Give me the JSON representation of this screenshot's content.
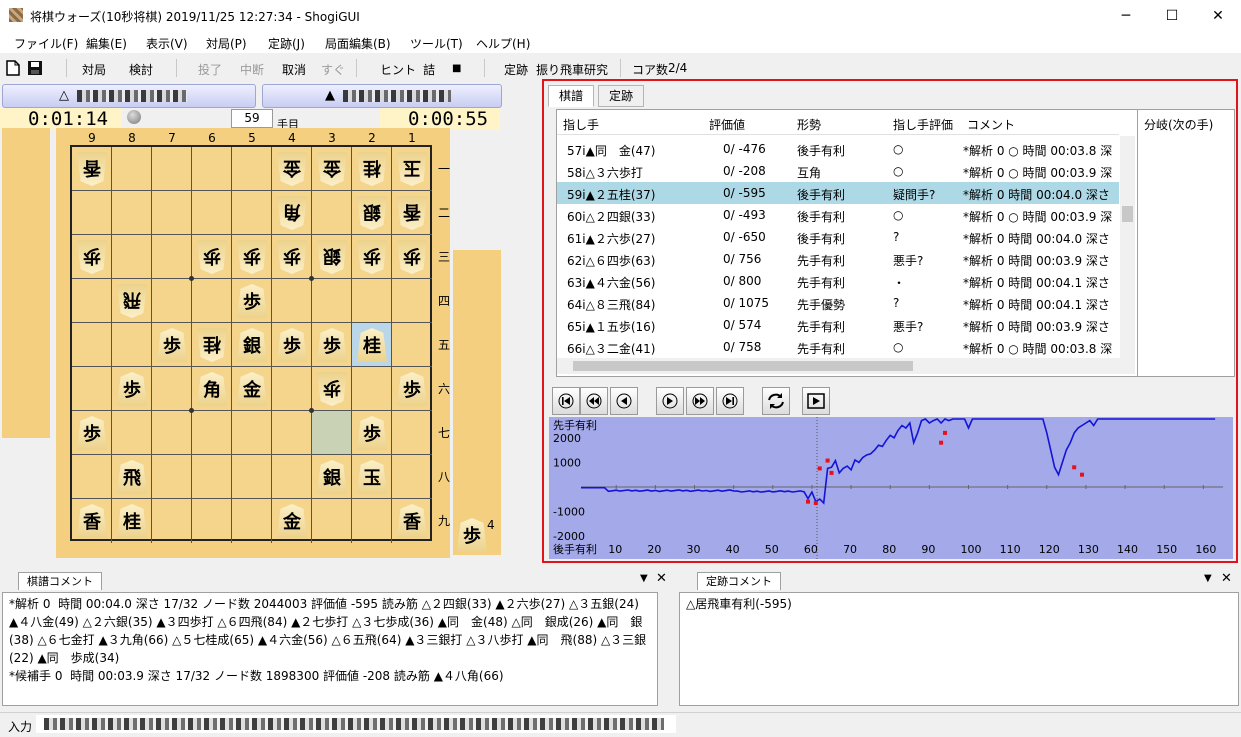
{
  "window": {
    "title": "将棋ウォーズ(10秒将棋) 2019/11/25 12:27:34 - ShogiGUI",
    "minimize": "─",
    "maximize": "☐",
    "close": "✕"
  },
  "menu": [
    "ファイル(F)",
    "編集(E)",
    "表示(V)",
    "対局(P)",
    "定跡(J)",
    "局面編集(B)",
    "ツール(T)",
    "ヘルプ(H)"
  ],
  "toolbar": {
    "game": "対局",
    "study": "検討",
    "resign": "投了",
    "pause": "中断",
    "undo": "取消",
    "now": "すぐ",
    "hint": "ヒント",
    "mate": "詰",
    "stop": "■",
    "joseki_label": "定跡",
    "joseki_value": "振り飛車研究",
    "cores_label": "コア数",
    "cores_value": "2/4"
  },
  "players": {
    "gote_mark": "△",
    "sente_mark": "▲"
  },
  "clocks": {
    "gote": "0:01:14",
    "sente": "0:00:55",
    "move_number": "59",
    "move_suffix": "手目"
  },
  "board": {
    "files": [
      "9",
      "8",
      "7",
      "6",
      "5",
      "4",
      "3",
      "2",
      "1"
    ],
    "ranks": [
      "一",
      "二",
      "三",
      "四",
      "五",
      "六",
      "七",
      "八",
      "九"
    ],
    "pieces": [
      {
        "f": 9,
        "r": 1,
        "p": "香",
        "gote": true
      },
      {
        "f": 4,
        "r": 1,
        "p": "金",
        "gote": true
      },
      {
        "f": 3,
        "r": 1,
        "p": "金",
        "gote": true
      },
      {
        "f": 2,
        "r": 1,
        "p": "桂",
        "gote": true
      },
      {
        "f": 1,
        "r": 1,
        "p": "玉",
        "gote": true
      },
      {
        "f": 4,
        "r": 2,
        "p": "角",
        "gote": true
      },
      {
        "f": 2,
        "r": 2,
        "p": "銀",
        "gote": true
      },
      {
        "f": 1,
        "r": 2,
        "p": "香",
        "gote": true
      },
      {
        "f": 9,
        "r": 3,
        "p": "歩",
        "gote": true
      },
      {
        "f": 6,
        "r": 3,
        "p": "歩",
        "gote": true
      },
      {
        "f": 5,
        "r": 3,
        "p": "歩",
        "gote": true
      },
      {
        "f": 4,
        "r": 3,
        "p": "歩",
        "gote": true
      },
      {
        "f": 3,
        "r": 3,
        "p": "銀",
        "gote": true
      },
      {
        "f": 2,
        "r": 3,
        "p": "歩",
        "gote": true
      },
      {
        "f": 1,
        "r": 3,
        "p": "歩",
        "gote": true
      },
      {
        "f": 8,
        "r": 4,
        "p": "飛",
        "gote": true
      },
      {
        "f": 5,
        "r": 4,
        "p": "歩",
        "gote": false
      },
      {
        "f": 7,
        "r": 5,
        "p": "歩",
        "gote": false
      },
      {
        "f": 6,
        "r": 5,
        "p": "桂",
        "gote": true
      },
      {
        "f": 5,
        "r": 5,
        "p": "銀",
        "gote": false
      },
      {
        "f": 4,
        "r": 5,
        "p": "歩",
        "gote": false
      },
      {
        "f": 3,
        "r": 5,
        "p": "歩",
        "gote": false
      },
      {
        "f": 2,
        "r": 5,
        "p": "桂",
        "gote": false
      },
      {
        "f": 8,
        "r": 6,
        "p": "歩",
        "gote": false
      },
      {
        "f": 6,
        "r": 6,
        "p": "角",
        "gote": false
      },
      {
        "f": 5,
        "r": 6,
        "p": "金",
        "gote": false
      },
      {
        "f": 3,
        "r": 6,
        "p": "歩",
        "gote": true
      },
      {
        "f": 1,
        "r": 6,
        "p": "歩",
        "gote": false
      },
      {
        "f": 9,
        "r": 7,
        "p": "歩",
        "gote": false
      },
      {
        "f": 2,
        "r": 7,
        "p": "歩",
        "gote": false
      },
      {
        "f": 8,
        "r": 8,
        "p": "飛",
        "gote": false
      },
      {
        "f": 3,
        "r": 8,
        "p": "銀",
        "gote": false
      },
      {
        "f": 2,
        "r": 8,
        "p": "玉",
        "gote": false
      },
      {
        "f": 9,
        "r": 9,
        "p": "香",
        "gote": false
      },
      {
        "f": 8,
        "r": 9,
        "p": "桂",
        "gote": false
      },
      {
        "f": 4,
        "r": 9,
        "p": "金",
        "gote": false
      },
      {
        "f": 1,
        "r": 9,
        "p": "香",
        "gote": false
      }
    ],
    "hand_sente": {
      "piece": "歩",
      "count": "4"
    }
  },
  "kifu": {
    "tabs": [
      "棋譜",
      "定跡"
    ],
    "headers": [
      "指し手",
      "評価値",
      "形勢",
      "指し手評価",
      "コメント"
    ],
    "branch_header": "分岐(次の手)",
    "selected_index": 2,
    "rows": [
      {
        "move": "57i▲同　金(47)",
        "eval": "0/ -476",
        "status": "後手有利",
        "judge": "○",
        "comment": "*解析 0 ○ 時間 00:03.8 深"
      },
      {
        "move": "58i△３六歩打",
        "eval": "0/ -208",
        "status": "互角",
        "judge": "○",
        "comment": "*解析 0 ○ 時間 00:03.9 深"
      },
      {
        "move": "59i▲２五桂(37)",
        "eval": "0/ -595",
        "status": "後手有利",
        "judge": "疑問手?",
        "comment": "*解析 0  時間 00:04.0 深さ"
      },
      {
        "move": "60i△２四銀(33)",
        "eval": "0/ -493",
        "status": "後手有利",
        "judge": "○",
        "comment": "*解析 0 ○ 時間 00:03.9 深"
      },
      {
        "move": "61i▲２六歩(27)",
        "eval": "0/ -650",
        "status": "後手有利",
        "judge": "?",
        "comment": "*解析 0  時間 00:04.0 深さ"
      },
      {
        "move": "62i△６四歩(63)",
        "eval": "0/  756",
        "status": "先手有利",
        "judge": "悪手?",
        "comment": "*解析 0  時間 00:03.9 深さ"
      },
      {
        "move": "63i▲４六金(56)",
        "eval": "0/  800",
        "status": "先手有利",
        "judge": "・",
        "comment": "*解析 0  時間 00:04.1 深さ"
      },
      {
        "move": "64i△８三飛(84)",
        "eval": "0/ 1075",
        "status": "先手優勢",
        "judge": "?",
        "comment": "*解析 0  時間 00:04.1 深さ"
      },
      {
        "move": "65i▲１五歩(16)",
        "eval": "0/  574",
        "status": "先手有利",
        "judge": "悪手?",
        "comment": "*解析 0  時間 00:03.9 深さ"
      },
      {
        "move": "66i△３二金(41)",
        "eval": "0/  758",
        "status": "先手有利",
        "judge": "○",
        "comment": "*解析 0 ○ 時間 00:03.8 深"
      }
    ]
  },
  "graph": {
    "top_label": "先手有利",
    "bottom_label": "後手有利",
    "y_labels": [
      "2000",
      "1000",
      "-1000",
      "-2000"
    ],
    "x_labels": [
      "10",
      "20",
      "30",
      "40",
      "50",
      "60",
      "70",
      "80",
      "90",
      "100",
      "110",
      "120",
      "130",
      "140",
      "150",
      "160"
    ]
  },
  "kifu_comment": {
    "title": "棋譜コメント",
    "text": "*解析 0  時間 00:04.0 深さ 17/32 ノード数 2044003 評価値 -595 読み筋 △２四銀(33) ▲２六歩(27) △３五銀(24) ▲４八金(49) △２六銀(35) ▲３四歩打 △６四飛(84) ▲２七歩打 △３七歩成(36) ▲同　金(48) △同　銀成(26) ▲同　銀(38) △６七金打 ▲３九角(66) △５七桂成(65) ▲４六金(56) △６五飛(64) ▲３三銀打 △３八歩打 ▲同　飛(88) △３三銀(22) ▲同　歩成(34)\n*候補手 0  時間 00:03.9 深さ 17/32 ノード数 1898300 評価値 -208 読み筋 ▲４八角(66)"
  },
  "joseki_comment": {
    "title": "定跡コメント",
    "text": "△居飛車有利(-595)"
  },
  "status": {
    "label": "入力"
  },
  "icons": {
    "new": "new-file-icon",
    "save": "save-icon",
    "refresh": "refresh-icon"
  }
}
